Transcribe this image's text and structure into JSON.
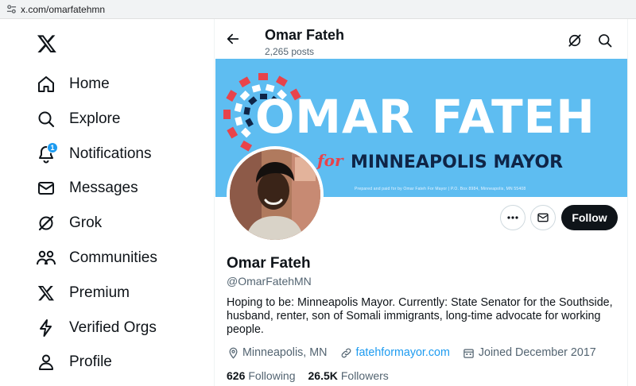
{
  "browser": {
    "url": "x.com/omarfatehmn"
  },
  "sidebar": {
    "items": [
      {
        "label": "Home",
        "icon": "home-icon"
      },
      {
        "label": "Explore",
        "icon": "search-icon"
      },
      {
        "label": "Notifications",
        "icon": "bell-icon",
        "badge": "1"
      },
      {
        "label": "Messages",
        "icon": "envelope-icon"
      },
      {
        "label": "Grok",
        "icon": "grok-icon"
      },
      {
        "label": "Communities",
        "icon": "people-icon"
      },
      {
        "label": "Premium",
        "icon": "x-logo-icon"
      },
      {
        "label": "Verified Orgs",
        "icon": "lightning-icon"
      },
      {
        "label": "Profile",
        "icon": "person-icon"
      }
    ]
  },
  "header": {
    "name": "Omar Fateh",
    "posts": "2,265 posts"
  },
  "banner": {
    "title": "OMAR FATEH",
    "for": "for",
    "subtitle": "MINNEAPOLIS MAYOR",
    "fine_print": "Prepared and paid for by Omar Fateh For Mayor | P.O. Box 8984, Minneapolis, MN 55408",
    "color": "#5ebdf1"
  },
  "actions": {
    "follow": "Follow"
  },
  "profile": {
    "name": "Omar Fateh",
    "handle": "@OmarFatehMN",
    "bio": "Hoping to be: Minneapolis Mayor. Currently: State Senator for the Southside, husband, renter, son of Somali immigrants, long-time advocate for working people.",
    "location": "Minneapolis, MN",
    "website": "fatehformayor.com",
    "joined": "Joined December 2017",
    "following_count": "626",
    "following_label": "Following",
    "followers_count": "26.5K",
    "followers_label": "Followers"
  },
  "colors": {
    "accent": "#1d9bf0",
    "text": "#0f1419",
    "muted": "#536471"
  }
}
